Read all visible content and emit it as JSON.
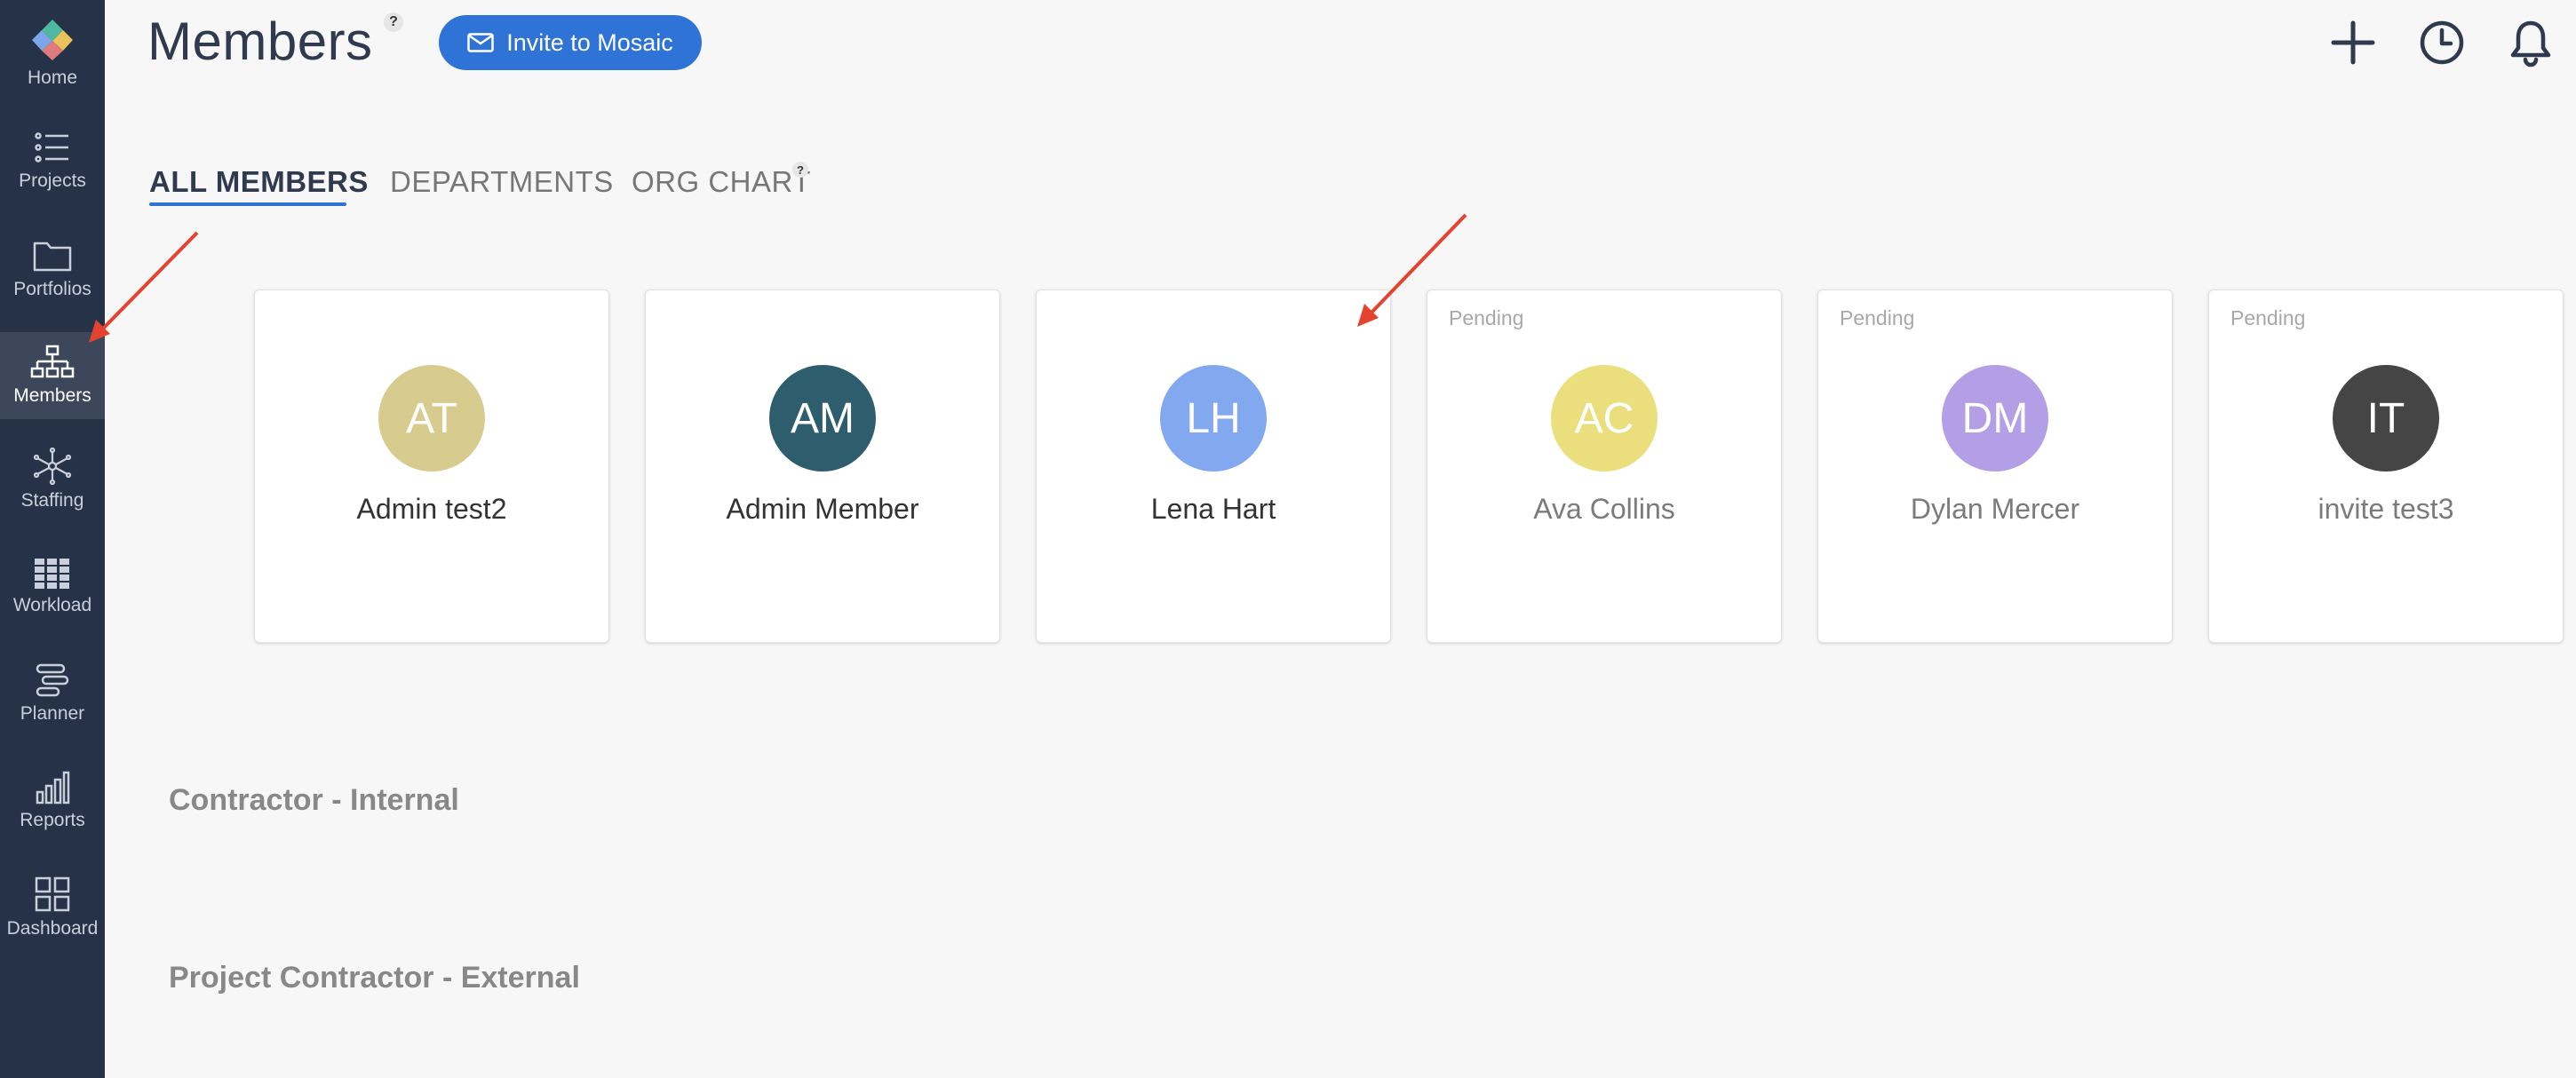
{
  "sidebar": {
    "items": [
      {
        "label": "Home",
        "icon": "mosaic-logo-icon"
      },
      {
        "label": "Projects",
        "icon": "list-icon"
      },
      {
        "label": "Portfolios",
        "icon": "folder-icon"
      },
      {
        "label": "Members",
        "icon": "org-chart-icon",
        "active": true
      },
      {
        "label": "Staffing",
        "icon": "network-icon"
      },
      {
        "label": "Workload",
        "icon": "grid-icon"
      },
      {
        "label": "Planner",
        "icon": "planner-icon"
      },
      {
        "label": "Reports",
        "icon": "bar-chart-icon"
      },
      {
        "label": "Dashboard",
        "icon": "dashboard-icon"
      }
    ]
  },
  "header": {
    "title": "Members",
    "help": "?",
    "invite_label": "Invite to Mosaic"
  },
  "tabs": [
    {
      "label": "ALL MEMBERS",
      "active": true
    },
    {
      "label": "DEPARTMENTS"
    },
    {
      "label": "ORG CHART",
      "help": "?"
    }
  ],
  "members": [
    {
      "initials": "AT",
      "name": "Admin test2",
      "pending": "",
      "color": "#d8cb8e"
    },
    {
      "initials": "AM",
      "name": "Admin Member",
      "pending": "",
      "color": "#2e5e6e"
    },
    {
      "initials": "LH",
      "name": "Lena Hart",
      "pending": "",
      "color": "#82a9ef"
    },
    {
      "initials": "AC",
      "name": "Ava Collins",
      "pending": "Pending",
      "color": "#eadf7c"
    },
    {
      "initials": "DM",
      "name": "Dylan Mercer",
      "pending": "Pending",
      "color": "#b49ee6"
    },
    {
      "initials": "IT",
      "name": "invite test3",
      "pending": "Pending",
      "color": "#454545"
    }
  ],
  "sections": [
    {
      "title": "Contractor - Internal"
    },
    {
      "title": "Project Contractor - External"
    }
  ],
  "colors": {
    "sidebar_bg": "#263247",
    "accent": "#2f73d6",
    "annotation_arrow": "#e3432f"
  }
}
